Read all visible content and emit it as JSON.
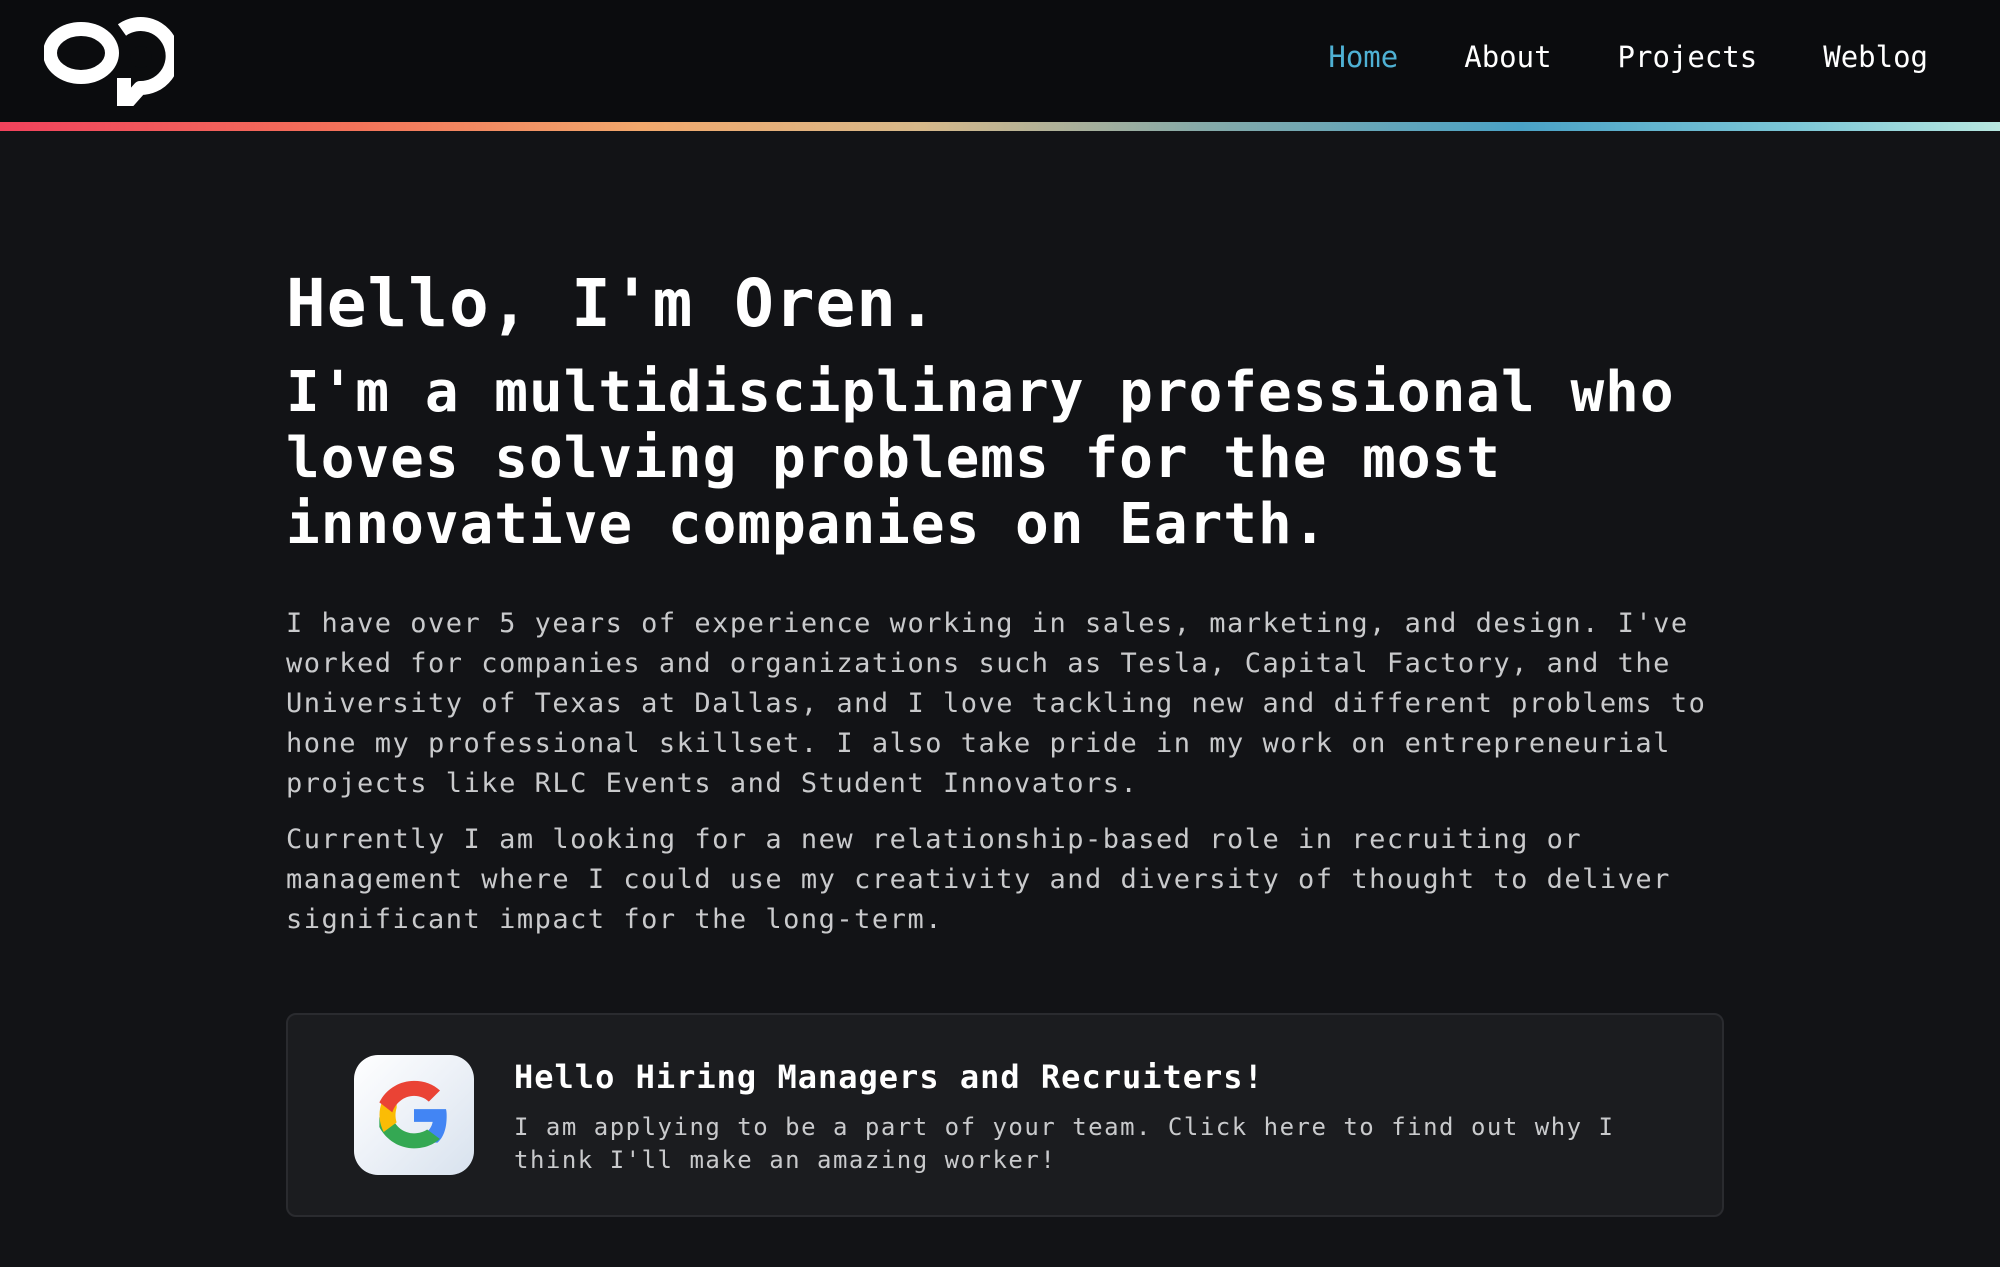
{
  "header": {
    "logo_alt": "OP",
    "nav": [
      {
        "label": "Home",
        "active": true
      },
      {
        "label": "About",
        "active": false
      },
      {
        "label": "Projects",
        "active": false
      },
      {
        "label": "Weblog",
        "active": false
      }
    ]
  },
  "hero": {
    "title": "Hello, I'm Oren.",
    "subtitle": "I'm a multidisciplinary professional who loves solving problems for the most innovative companies on Earth."
  },
  "intro": {
    "paragraph1": "I have over 5 years of experience working in sales, marketing, and design. I've worked for companies and organizations such as Tesla, Capital Factory, and the University of Texas at Dallas, and I love tackling new and different problems to hone my professional skillset. I also take pride in my work on entrepreneurial projects like RLC Events and Student Innovators.",
    "paragraph2": "Currently I am looking for a new relationship-based role in recruiting or management where I could use my creativity and diversity of thought to deliver significant impact for the long-term."
  },
  "card": {
    "icon": "google-icon",
    "title": "Hello Hiring Managers and Recruiters!",
    "text": "I am applying to be a part of your team. Click here to find out why I think I'll make an amazing worker!"
  },
  "colors": {
    "background": "#121316",
    "header_background": "#0b0c0e",
    "nav_active": "#4fb1d4",
    "gradient_start": "#f2425c",
    "gradient_end": "#b8e8e0"
  }
}
